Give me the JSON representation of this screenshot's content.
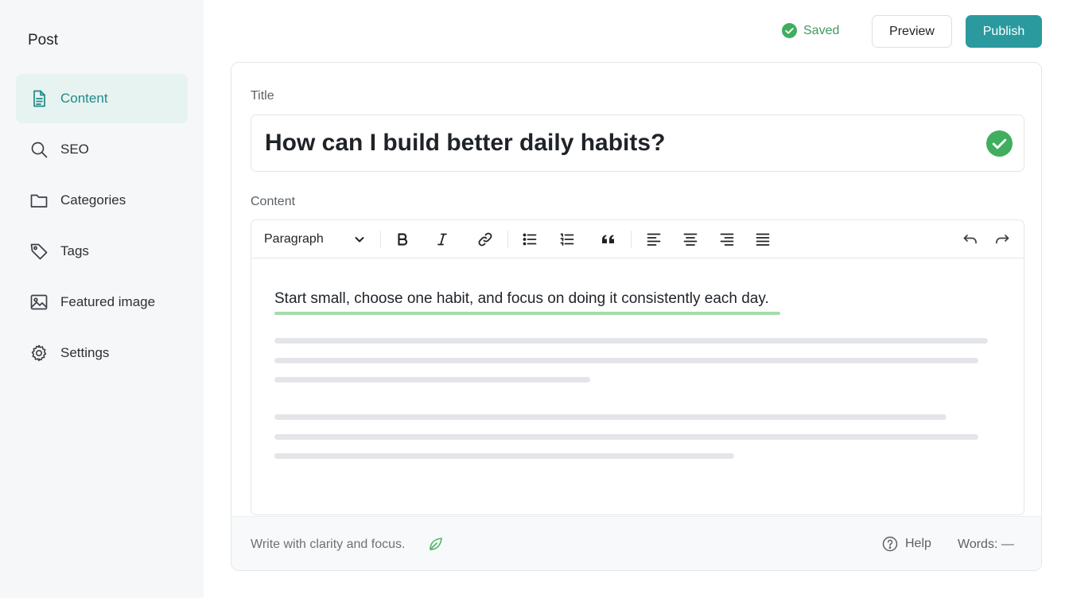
{
  "sidebar": {
    "title": "Post",
    "items": [
      {
        "label": "Content",
        "icon": "document-icon",
        "active": true
      },
      {
        "label": "SEO",
        "icon": "search-icon"
      },
      {
        "label": "Categories",
        "icon": "folder-icon"
      },
      {
        "label": "Tags",
        "icon": "tag-icon"
      },
      {
        "label": "Featured image",
        "icon": "image-icon"
      },
      {
        "label": "Settings",
        "icon": "gear-icon"
      }
    ]
  },
  "header": {
    "status": "Saved",
    "preview_label": "Preview",
    "publish_label": "Publish"
  },
  "form": {
    "title_label": "Title",
    "title_value": "How can I build better daily habits?",
    "content_label": "Content"
  },
  "editor": {
    "block_format": "Paragraph",
    "text": "Start small, choose one habit, and focus on doing it consistently each day."
  },
  "footer": {
    "note": "Write with clarity and focus.",
    "help_label": "Help",
    "word_count": "Words: —"
  },
  "colors": {
    "accent": "#2a9a9e",
    "success": "#3f9a5c",
    "active_bg": "#e7f3f1"
  }
}
